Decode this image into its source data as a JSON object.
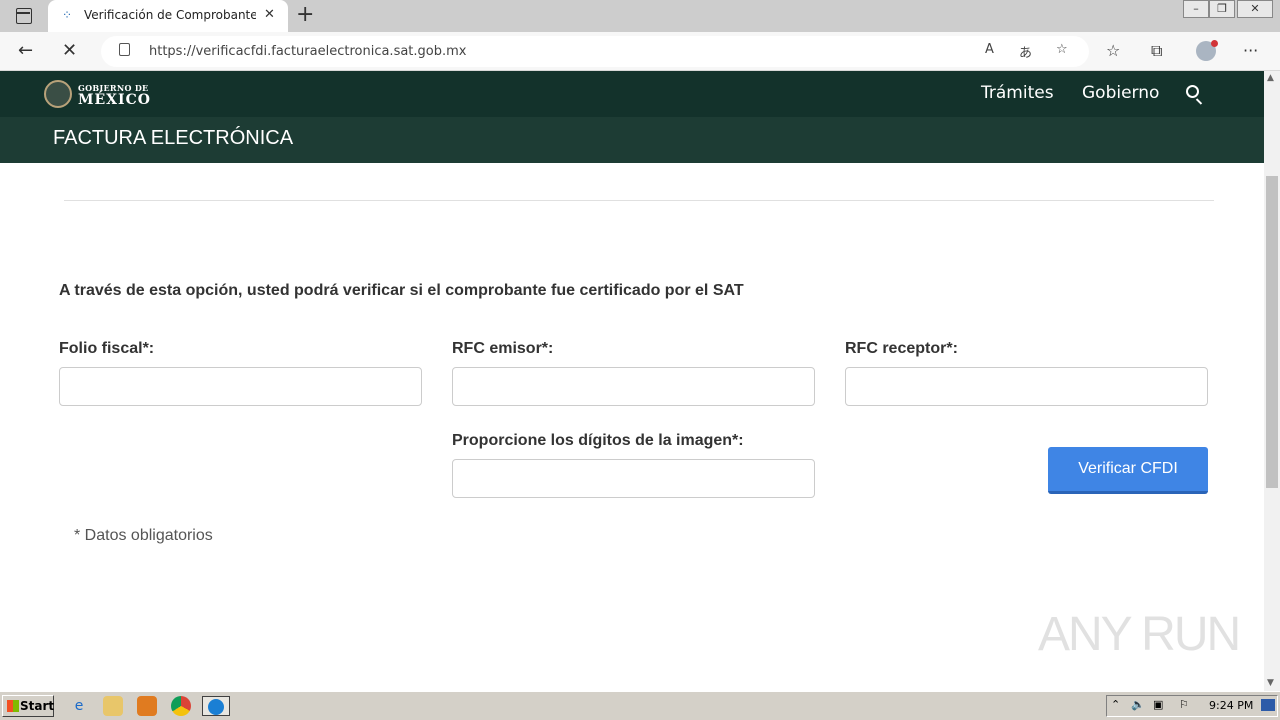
{
  "browser": {
    "tab_title": "Verificación de Comprobantes Fi",
    "url": "https://verificacfdi.facturaelectronica.sat.gob.mx"
  },
  "gob_header": {
    "logo_top": "GOBIERNO DE",
    "logo_bottom": "MÉXICO",
    "nav": [
      "Trámites",
      "Gobierno"
    ]
  },
  "section_title": "FACTURA ELECTRÓNICA",
  "form": {
    "intro": "A través de esta opción, usted podrá verificar si el comprobante fue certificado por el SAT",
    "folio_label": "Folio fiscal*:",
    "rfc_emisor_label": "RFC emisor*:",
    "rfc_receptor_label": "RFC receptor*:",
    "captcha_label": "Proporcione los dígitos de la imagen*:",
    "submit": "Verificar CFDI",
    "required_note": "* Datos obligatorios"
  },
  "watermark": "ANY RUN",
  "taskbar": {
    "start": "Start",
    "clock": "9:24 PM"
  }
}
